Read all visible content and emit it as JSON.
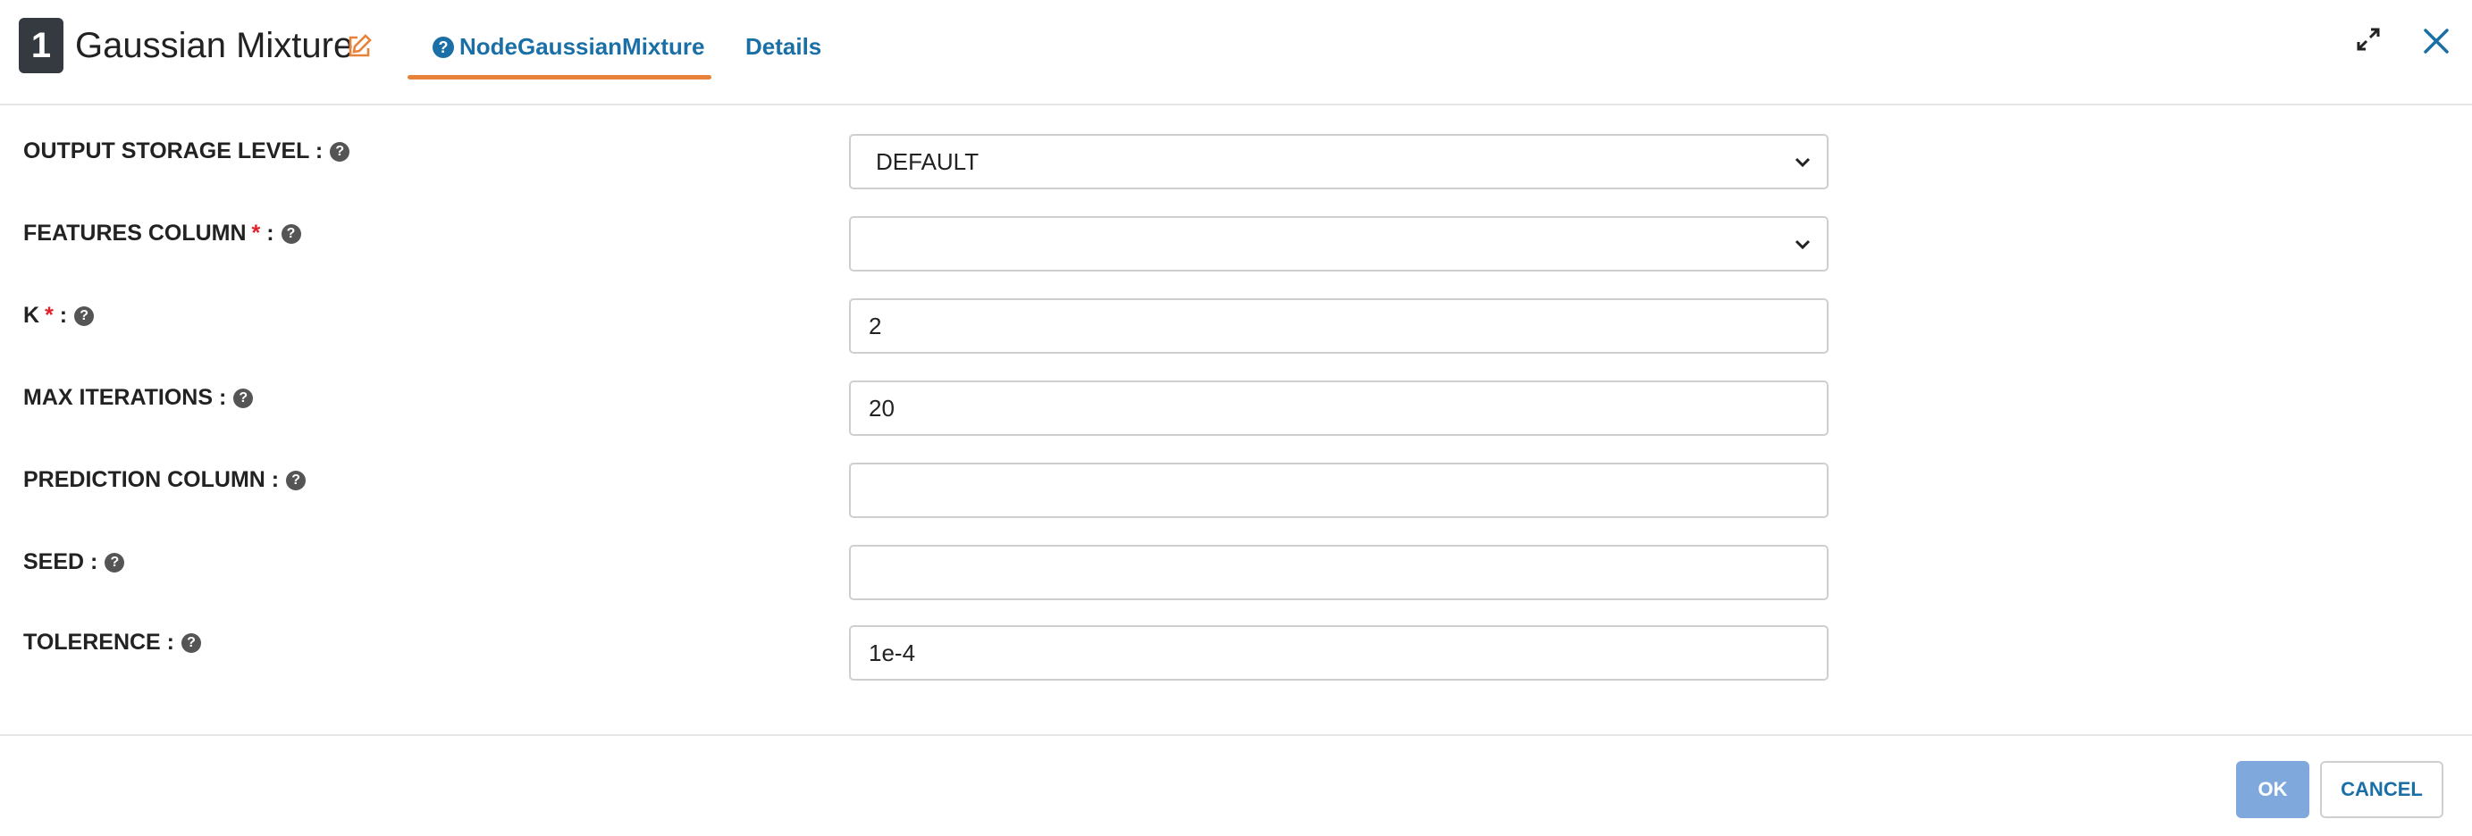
{
  "header": {
    "node_number": "1",
    "title": "Gaussian Mixture",
    "tabs": [
      {
        "label": "NodeGaussianMixture",
        "icon": "question-circle-icon",
        "active": true
      },
      {
        "label": "Details",
        "active": false
      }
    ],
    "accent_color": "#e8823a",
    "link_color": "#1a6fa6"
  },
  "form": {
    "output_storage_level": {
      "label": "OUTPUT STORAGE LEVEL :",
      "value": "DEFAULT"
    },
    "features_column": {
      "label": "FEATURES COLUMN",
      "required_mark": "*",
      "suffix": ":",
      "value": ""
    },
    "k": {
      "label": "K",
      "required_mark": "*",
      "suffix": ":",
      "value": "2"
    },
    "max_iterations": {
      "label": "MAX ITERATIONS :",
      "value": "20"
    },
    "prediction_column": {
      "label": "PREDICTION COLUMN :",
      "value": ""
    },
    "seed": {
      "label": "SEED :",
      "value": ""
    },
    "tolerence": {
      "label": "TOLERENCE :",
      "value": "1e-4"
    }
  },
  "footer": {
    "ok_label": "OK",
    "cancel_label": "CANCEL"
  }
}
